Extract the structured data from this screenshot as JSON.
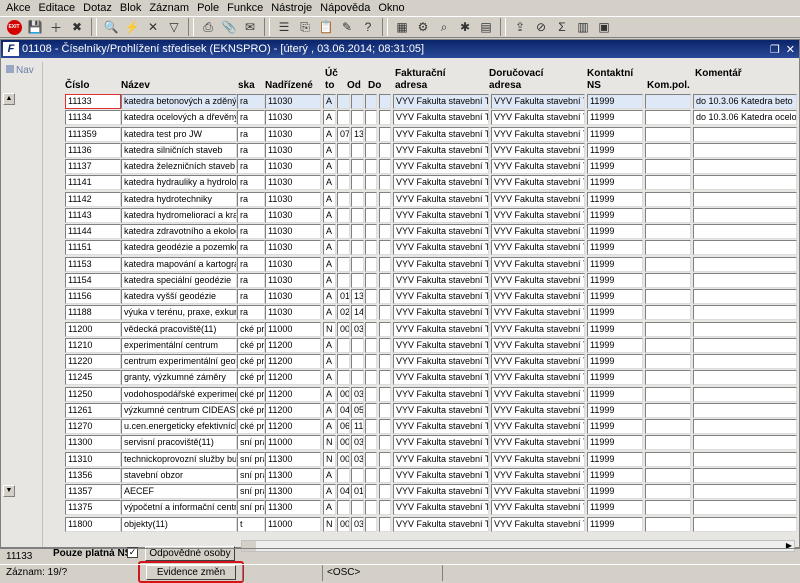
{
  "menu": [
    "Akce",
    "Editace",
    "Dotaz",
    "Blok",
    "Záznam",
    "Pole",
    "Funkce",
    "Nástroje",
    "Nápověda",
    "Okno"
  ],
  "toolbar": {
    "exit_label": "EXIT",
    "icons": [
      "exit-icon",
      "save-icon",
      "new-record-icon",
      "delete-record-icon",
      "enter-query-icon",
      "execute-query-icon",
      "cancel-query-icon",
      "filter-icon",
      "print-icon",
      "attach-icon",
      "mail-icon",
      "list-icon",
      "copy-icon",
      "paste-icon",
      "edit-icon",
      "help-icon",
      "calendar-icon",
      "settings-icon",
      "find-icon",
      "notes-icon",
      "chart-icon",
      "export-icon",
      "stop-icon",
      "sum-icon",
      "sigma-icon",
      "window-icon"
    ]
  },
  "window": {
    "title": "01108 - Číselníky/Prohlížení středisek (EKNSPRO) - [úterý  , 03.06.2014; 08:31:05]",
    "app_icon": "F",
    "nav_label": "Nav"
  },
  "columns": {
    "cislo": "Číslo",
    "nazev": "Název",
    "ska": "ska",
    "nadrizene": "Nadřízené",
    "ucto_1": "Úč",
    "ucto_2": "to",
    "od": "Od",
    "do": "Do",
    "fakt_1": "Fakturační",
    "fakt_2": "adresa",
    "doruc_1": "Doručovací",
    "doruc_2": "adresa",
    "kont_1": "Kontaktní",
    "kont_2": "NS",
    "kompol": "Kom.pol.",
    "komentar": "Komentář"
  },
  "rows": [
    {
      "cislo": "11133",
      "nazev": "katedra betonových a zděných",
      "ska": "ra",
      "nadr": "11030",
      "ucto": "A",
      "od": "",
      "do": "",
      "fakt": "VYV Fakulta stavební Th",
      "doruc": "VYV Fakulta stavební Th",
      "kont": "11999",
      "kom": "",
      "komentar": "do 10.3.06 Katedra beto"
    },
    {
      "cislo": "11134",
      "nazev": "katedra ocelových a dřevěný",
      "ska": "ra",
      "nadr": "11030",
      "ucto": "A",
      "od": "",
      "do": "",
      "fakt": "VYV Fakulta stavební Th",
      "doruc": "VYV Fakulta stavební Th",
      "kont": "11999",
      "kom": "",
      "komentar": "do 10.3.06 Katedra ocelo"
    },
    {
      "cislo": "111359",
      "nazev": "katedra test pro JW",
      "ska": "ra",
      "nadr": "11030",
      "ucto": "A",
      "od": "07",
      "do": "13",
      "fakt": "VYV Fakulta stavební Th",
      "doruc": "VYV Fakulta stavební Th",
      "kont": "11999",
      "kom": "",
      "komentar": ""
    },
    {
      "cislo": "11136",
      "nazev": "katedra silničních staveb",
      "ska": "ra",
      "nadr": "11030",
      "ucto": "A",
      "od": "",
      "do": "",
      "fakt": "VYV Fakulta stavební Th",
      "doruc": "VYV Fakulta stavební Th",
      "kont": "11999",
      "kom": "",
      "komentar": ""
    },
    {
      "cislo": "11137",
      "nazev": "katedra železničních staveb",
      "ska": "ra",
      "nadr": "11030",
      "ucto": "A",
      "od": "",
      "do": "",
      "fakt": "VYV Fakulta stavební Th",
      "doruc": "VYV Fakulta stavební Th",
      "kont": "11999",
      "kom": "",
      "komentar": ""
    },
    {
      "cislo": "11141",
      "nazev": "katedra hydrauliky a hydrolog",
      "ska": "ra",
      "nadr": "11030",
      "ucto": "A",
      "od": "",
      "do": "",
      "fakt": "VYV Fakulta stavební Th",
      "doruc": "VYV Fakulta stavební Th",
      "kont": "11999",
      "kom": "",
      "komentar": ""
    },
    {
      "cislo": "11142",
      "nazev": "katedra hydrotechniky",
      "ska": "ra",
      "nadr": "11030",
      "ucto": "A",
      "od": "",
      "do": "",
      "fakt": "VYV Fakulta stavební Th",
      "doruc": "VYV Fakulta stavební Th",
      "kont": "11999",
      "kom": "",
      "komentar": ""
    },
    {
      "cislo": "11143",
      "nazev": "katedra hydromeliorací a kraji",
      "ska": "ra",
      "nadr": "11030",
      "ucto": "A",
      "od": "",
      "do": "",
      "fakt": "VYV Fakulta stavební Th",
      "doruc": "VYV Fakulta stavební Th",
      "kont": "11999",
      "kom": "",
      "komentar": ""
    },
    {
      "cislo": "11144",
      "nazev": "katedra zdravotního a ekolog",
      "ska": "ra",
      "nadr": "11030",
      "ucto": "A",
      "od": "",
      "do": "",
      "fakt": "VYV Fakulta stavební Th",
      "doruc": "VYV Fakulta stavební Th",
      "kont": "11999",
      "kom": "",
      "komentar": ""
    },
    {
      "cislo": "11151",
      "nazev": "katedra geodézie a pozemkov",
      "ska": "ra",
      "nadr": "11030",
      "ucto": "A",
      "od": "",
      "do": "",
      "fakt": "VYV Fakulta stavební Th",
      "doruc": "VYV Fakulta stavební Th",
      "kont": "11999",
      "kom": "",
      "komentar": ""
    },
    {
      "cislo": "11153",
      "nazev": "katedra mapování a kartograf",
      "ska": "ra",
      "nadr": "11030",
      "ucto": "A",
      "od": "",
      "do": "",
      "fakt": "VYV Fakulta stavební Th",
      "doruc": "VYV Fakulta stavební Th",
      "kont": "11999",
      "kom": "",
      "komentar": ""
    },
    {
      "cislo": "11154",
      "nazev": "katedra speciální geodézie",
      "ska": "ra",
      "nadr": "11030",
      "ucto": "A",
      "od": "",
      "do": "",
      "fakt": "VYV Fakulta stavební Th",
      "doruc": "VYV Fakulta stavební Th",
      "kont": "11999",
      "kom": "",
      "komentar": ""
    },
    {
      "cislo": "11156",
      "nazev": "katedra vyšší geodézie",
      "ska": "ra",
      "nadr": "11030",
      "ucto": "A",
      "od": "01",
      "do": "13",
      "fakt": "VYV Fakulta stavební Th",
      "doruc": "VYV Fakulta stavební Th",
      "kont": "11999",
      "kom": "",
      "komentar": ""
    },
    {
      "cislo": "11188",
      "nazev": "výuka v terénu, praxe, exkur",
      "ska": "ra",
      "nadr": "11030",
      "ucto": "A",
      "od": "02",
      "do": "14",
      "fakt": "VYV Fakulta stavební Th",
      "doruc": "VYV Fakulta stavební Th",
      "kont": "11999",
      "kom": "",
      "komentar": ""
    },
    {
      "cislo": "11200",
      "nazev": "vědecká pracoviště(11)",
      "ska": "cké pra",
      "nadr": "11000",
      "ucto": "N",
      "od": "00",
      "do": "03",
      "fakt": "VYV Fakulta stavební Th",
      "doruc": "VYV Fakulta stavební Th",
      "kont": "11999",
      "kom": "",
      "komentar": ""
    },
    {
      "cislo": "11210",
      "nazev": "experimentální centrum",
      "ska": "cké pra",
      "nadr": "11200",
      "ucto": "A",
      "od": "",
      "do": "",
      "fakt": "VYV Fakulta stavební Th",
      "doruc": "VYV Fakulta stavební Th",
      "kont": "11999",
      "kom": "",
      "komentar": ""
    },
    {
      "cislo": "11220",
      "nazev": "centrum experimentální geote",
      "ska": "cké pra",
      "nadr": "11200",
      "ucto": "A",
      "od": "",
      "do": "",
      "fakt": "VYV Fakulta stavební Th",
      "doruc": "VYV Fakulta stavební Th",
      "kont": "11999",
      "kom": "",
      "komentar": ""
    },
    {
      "cislo": "11245",
      "nazev": "granty, výzkumné záměry",
      "ska": "cké pra",
      "nadr": "11200",
      "ucto": "A",
      "od": "",
      "do": "",
      "fakt": "VYV Fakulta stavební Th",
      "doruc": "VYV Fakulta stavební Th",
      "kont": "11999",
      "kom": "",
      "komentar": ""
    },
    {
      "cislo": "11250",
      "nazev": "vodohospodářské experimen",
      "ska": "cké pra",
      "nadr": "11200",
      "ucto": "A",
      "od": "00",
      "do": "03",
      "fakt": "VYV Fakulta stavební Th",
      "doruc": "VYV Fakulta stavební Th",
      "kont": "11999",
      "kom": "",
      "komentar": ""
    },
    {
      "cislo": "11261",
      "nazev": "výzkumné centrum CIDEAS",
      "ska": "cké pra",
      "nadr": "11200",
      "ucto": "A",
      "od": "04",
      "do": "05",
      "fakt": "VYV Fakulta stavební Th",
      "doruc": "VYV Fakulta stavební Th",
      "kont": "11999",
      "kom": "",
      "komentar": ""
    },
    {
      "cislo": "11270",
      "nazev": "u.cen.energeticky efektivních",
      "ska": "cké pra",
      "nadr": "11200",
      "ucto": "A",
      "od": "06",
      "do": "11",
      "fakt": "VYV Fakulta stavební Th",
      "doruc": "VYV Fakulta stavební Th",
      "kont": "11999",
      "kom": "",
      "komentar": ""
    },
    {
      "cislo": "11300",
      "nazev": "servisní pracoviště(11)",
      "ska": "sní pra",
      "nadr": "11000",
      "ucto": "N",
      "od": "00",
      "do": "03",
      "fakt": "VYV Fakulta stavební Th",
      "doruc": "VYV Fakulta stavební Th",
      "kont": "11999",
      "kom": "",
      "komentar": ""
    },
    {
      "cislo": "11310",
      "nazev": "technickoprovozní služby bud",
      "ska": "sní pra",
      "nadr": "11300",
      "ucto": "N",
      "od": "00",
      "do": "03",
      "fakt": "VYV Fakulta stavební Th",
      "doruc": "VYV Fakulta stavební Th",
      "kont": "11999",
      "kom": "",
      "komentar": ""
    },
    {
      "cislo": "11356",
      "nazev": "stavební obzor",
      "ska": "sní pra",
      "nadr": "11300",
      "ucto": "A",
      "od": "",
      "do": "",
      "fakt": "VYV Fakulta stavební Th",
      "doruc": "VYV Fakulta stavební Th",
      "kont": "11999",
      "kom": "",
      "komentar": ""
    },
    {
      "cislo": "11357",
      "nazev": "AECEF",
      "ska": "sní pra",
      "nadr": "11300",
      "ucto": "A",
      "od": "04",
      "do": "01",
      "fakt": "VYV Fakulta stavební Th",
      "doruc": "VYV Fakulta stavební Th",
      "kont": "11999",
      "kom": "",
      "komentar": ""
    },
    {
      "cislo": "11375",
      "nazev": "výpočetní a informační centru",
      "ska": "sní pra",
      "nadr": "11300",
      "ucto": "A",
      "od": "",
      "do": "",
      "fakt": "VYV Fakulta stavební Th",
      "doruc": "VYV Fakulta stavební Th",
      "kont": "11999",
      "kom": "",
      "komentar": ""
    },
    {
      "cislo": "11800",
      "nazev": "objekty(11)",
      "ska": "t",
      "nadr": "11000",
      "ucto": "N",
      "od": "00",
      "do": "03",
      "fakt": "VYV Fakulta stavební Th",
      "doruc": "VYV Fakulta stavební Th",
      "kont": "11999",
      "kom": "",
      "komentar": ""
    }
  ],
  "footer": {
    "only_valid_label": "Pouze platná NS",
    "only_valid_checked": "✓",
    "responsible_button": "Odpovědné osoby",
    "evidence_button": "Evidence změn"
  },
  "status": {
    "field_value": "11133",
    "record": "Záznam: 19/?",
    "mode": "<OSC>"
  }
}
